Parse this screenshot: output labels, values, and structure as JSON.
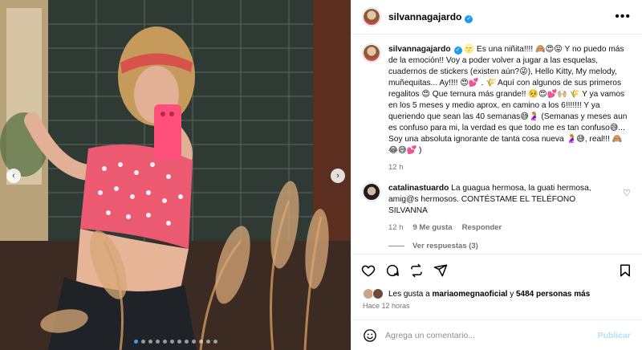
{
  "post": {
    "username": "silvannagajardo",
    "caption": "🌝 Es una niñita!!!! 🙈😍😝 Y no puedo más de la emoción!! Voy a poder volver a jugar a las esquelas, cuadernos de stickers (existen aún?😜), Hello Kitty, My melody, muñequitas... Ay!!!! 😍💕 . 🌾 Aquí con algunos de sus primeros regalitos 😍 Que ternura más grande!! 🥺😍💕🙌🏼 🌾 Y ya vamos en los 5 meses y medio aprox, en camino a los 6!!!!!!! Y ya queriendo que sean las 40 semanas😅🤰🏼 (Semanas y meses aun es confuso para mi, la verdad es que todo me es tan confuso😅... Soy una absoluta ignorante de tanta cosa nueva 🤰🏼😅, real!!! 🙈😂😅💕 )",
    "caption_time": "12 h"
  },
  "comments": [
    {
      "username": "catalinastuardo",
      "text": "La guagua hermosa, la guati hermosa, amig@s hermosos. CONTÉSTAME EL TELÉFONO SILVANNA",
      "time": "12 h",
      "likes": "9 Me gusta",
      "reply": "Responder",
      "view_replies": "Ver respuestas (3)"
    }
  ],
  "likes_bar": {
    "prefix": "Les gusta a",
    "first_user": "mariaomegnaoficial",
    "middle": "y",
    "others": "5484 personas más"
  },
  "posted_ago": "Hace 12 horas",
  "composer": {
    "placeholder": "Agrega un comentario...",
    "post_label": "Publicar"
  },
  "carousel": {
    "slides": 12,
    "active_index": 0
  },
  "colors": {
    "accent": "#0095f6",
    "verified": "#1d9bf0",
    "muted": "#737373"
  },
  "icons": [
    "more-icon",
    "heart-icon",
    "comment-icon",
    "share-icon",
    "send-icon",
    "bookmark-icon",
    "emoji-icon",
    "chevron-left-icon",
    "chevron-right-icon"
  ]
}
